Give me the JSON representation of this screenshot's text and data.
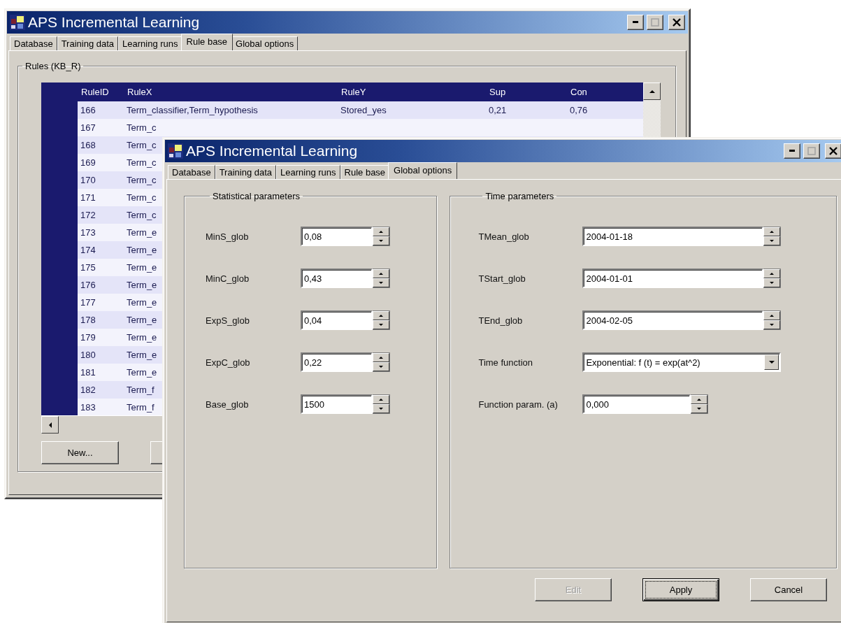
{
  "back_window": {
    "title": "APS Incremental Learning",
    "tabs": [
      {
        "label": "Database",
        "selected": false
      },
      {
        "label": "Training data",
        "selected": false
      },
      {
        "label": "Learning runs",
        "selected": false
      },
      {
        "label": "Rule base",
        "selected": true
      },
      {
        "label": "Global options",
        "selected": false
      }
    ],
    "group_title": "Rules (KB_R)",
    "table": {
      "columns": [
        "RuleID",
        "RuleX",
        "RuleY",
        "Sup",
        "Con"
      ],
      "rows": [
        [
          "166",
          "Term_classifier,Term_hypothesis",
          "Stored_yes",
          "0,21",
          "0,76"
        ],
        [
          "167",
          "Term_c"
        ],
        [
          "168",
          "Term_c"
        ],
        [
          "169",
          "Term_c"
        ],
        [
          "170",
          "Term_c"
        ],
        [
          "171",
          "Term_c"
        ],
        [
          "172",
          "Term_c"
        ],
        [
          "173",
          "Term_e"
        ],
        [
          "174",
          "Term_e"
        ],
        [
          "175",
          "Term_e"
        ],
        [
          "176",
          "Term_e"
        ],
        [
          "177",
          "Term_e"
        ],
        [
          "178",
          "Term_e"
        ],
        [
          "179",
          "Term_e"
        ],
        [
          "180",
          "Term_e"
        ],
        [
          "181",
          "Term_e"
        ],
        [
          "182",
          "Term_f"
        ],
        [
          "183",
          "Term_f"
        ]
      ]
    },
    "buttons": [
      "New..."
    ]
  },
  "front_window": {
    "title": "APS Incremental Learning",
    "tabs": [
      {
        "label": "Database",
        "selected": false
      },
      {
        "label": "Training data",
        "selected": false
      },
      {
        "label": "Learning runs",
        "selected": false
      },
      {
        "label": "Rule base",
        "selected": false
      },
      {
        "label": "Global options",
        "selected": true
      }
    ],
    "statistical": {
      "title": "Statistical parameters",
      "fields": [
        {
          "label": "MinS_glob",
          "value": "0,08"
        },
        {
          "label": "MinC_glob",
          "value": "0,43"
        },
        {
          "label": "ExpS_glob",
          "value": "0,04"
        },
        {
          "label": "ExpC_glob",
          "value": "0,22"
        },
        {
          "label": "Base_glob",
          "value": "1500"
        }
      ]
    },
    "time": {
      "title": "Time parameters",
      "fields": [
        {
          "kind": "spin",
          "label": "TMean_glob",
          "value": "2004-01-18"
        },
        {
          "kind": "spin",
          "label": "TStart_glob",
          "value": "2004-01-01"
        },
        {
          "kind": "spin",
          "label": "TEnd_glob",
          "value": "2004-02-05"
        },
        {
          "kind": "dropdown",
          "label": "Time function",
          "value": "Exponential: f (t) = exp(at^2)"
        },
        {
          "kind": "short_spin",
          "label": "Function param. (a)",
          "value": "0,000"
        }
      ]
    },
    "buttons": [
      {
        "label": "Edit",
        "disabled": true,
        "default": false
      },
      {
        "label": "Apply",
        "disabled": false,
        "default": true
      },
      {
        "label": "Cancel",
        "disabled": false,
        "default": false
      }
    ]
  }
}
